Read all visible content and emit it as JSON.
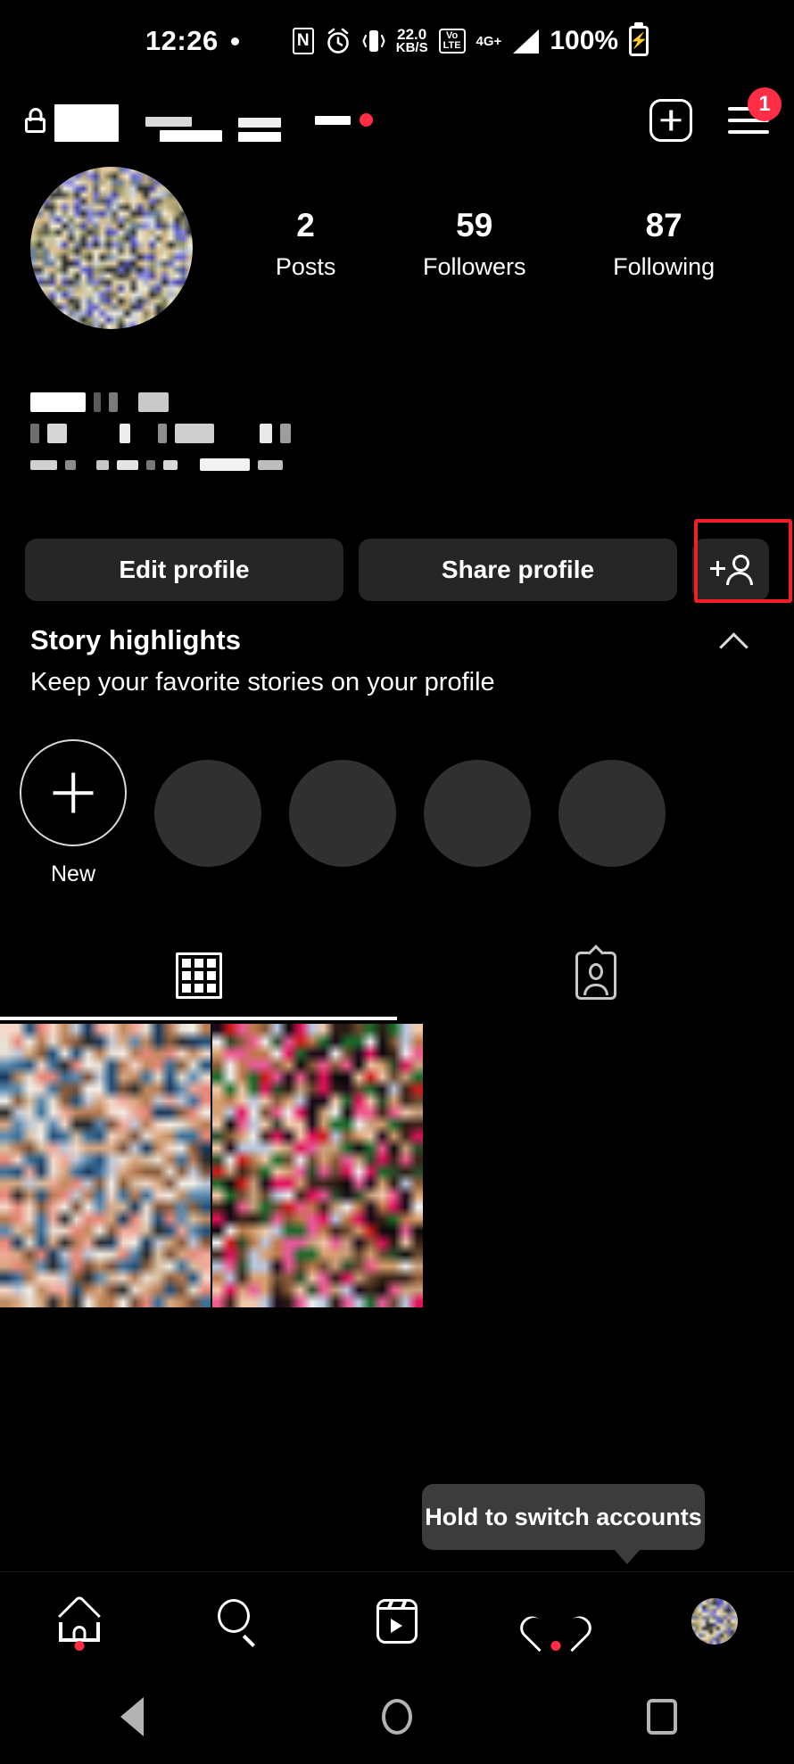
{
  "status_bar": {
    "time": "12:26",
    "dot_icon": "dot-icon",
    "nfc_label": "N",
    "alarm_icon": "alarm-icon",
    "vibrate_icon": "vibrate-icon",
    "data_speed_value": "22.0",
    "data_speed_unit": "KB/S",
    "volte_top": "Vo",
    "volte_bottom": "LTE",
    "network_type": "4G+",
    "battery_percent": "100%",
    "battery_icon": "battery-charging-icon"
  },
  "app_header": {
    "lock_icon": "lock-icon",
    "username_redacted": true,
    "chevron_down_icon": "chevron-down-icon",
    "status_dot_icon": "red-dot-icon",
    "create_button_label": "create-new-post",
    "menu_button_label": "menu",
    "menu_badge": "1"
  },
  "profile": {
    "avatar_label": "profile-avatar",
    "stats": [
      {
        "num": "2",
        "label": "Posts"
      },
      {
        "num": "59",
        "label": "Followers"
      },
      {
        "num": "87",
        "label": "Following"
      }
    ],
    "bio_redacted": true
  },
  "actions": {
    "edit_profile": "Edit profile",
    "share_profile": "Share profile",
    "add_friend_icon": "add-person-icon",
    "highlight_color": "#f31e28"
  },
  "story_highlights": {
    "title": "Story highlights",
    "subtitle": "Keep your favorite stories on your profile",
    "collapse_icon": "chevron-up-icon",
    "new_label": "New",
    "placeholder_count": 4
  },
  "tabs": [
    {
      "icon": "grid-icon",
      "name": "posts-grid-tab",
      "active": true
    },
    {
      "icon": "tagged-icon",
      "name": "tagged-tab",
      "active": false
    }
  ],
  "posts": {
    "count": 2,
    "items": [
      {
        "name": "post-thumbnail-1"
      },
      {
        "name": "post-thumbnail-2"
      }
    ]
  },
  "tooltip": {
    "text": "Hold to switch accounts"
  },
  "bottom_nav": [
    {
      "icon": "home-icon",
      "name": "nav-home",
      "badge_dot": true
    },
    {
      "icon": "search-icon",
      "name": "nav-search",
      "badge_dot": false
    },
    {
      "icon": "reels-icon",
      "name": "nav-reels",
      "badge_dot": false
    },
    {
      "icon": "heart-icon",
      "name": "nav-activity",
      "badge_dot": true
    },
    {
      "icon": "avatar-icon",
      "name": "nav-profile",
      "badge_dot": false
    }
  ],
  "system_nav": {
    "back_icon": "back-triangle-icon",
    "home_icon": "home-circle-icon",
    "recents_icon": "recents-square-icon"
  },
  "colors": {
    "background": "#000000",
    "button_bg": "#262626",
    "accent_red": "#ff2d45",
    "tooltip_bg": "#3c3c3c",
    "placeholder_circle": "#303030"
  }
}
